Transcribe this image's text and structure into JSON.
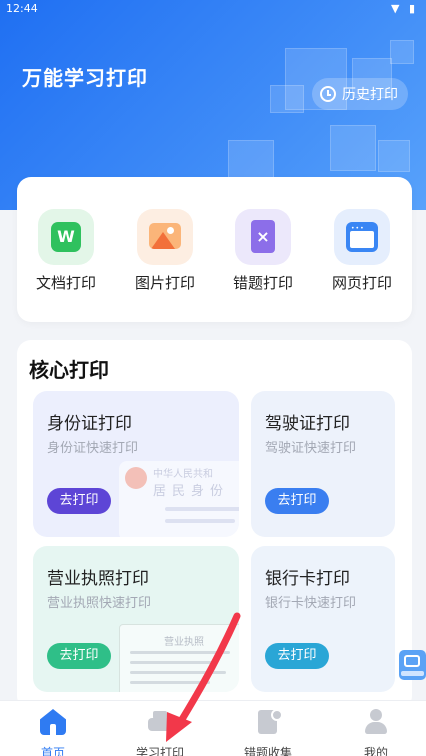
{
  "status_bar": {
    "time": "12:44",
    "icons": "▼ ▮"
  },
  "header": {
    "title": "万能学习打印",
    "history_label": "历史打印"
  },
  "quick_actions": [
    {
      "label": "文档打印",
      "icon": "word-doc-icon",
      "glyph": "W"
    },
    {
      "label": "图片打印",
      "icon": "image-icon"
    },
    {
      "label": "错题打印",
      "icon": "wrong-question-icon",
      "glyph": "×"
    },
    {
      "label": "网页打印",
      "icon": "web-page-icon",
      "glyph": "•••"
    }
  ],
  "core": {
    "title": "核心打印",
    "cards": [
      {
        "title": "身份证打印",
        "subtitle": "身份证快速打印",
        "button": "去打印",
        "art": {
          "line1": "中华人民共和",
          "line2": "居民身份"
        }
      },
      {
        "title": "驾驶证打印",
        "subtitle": "驾驶证快速打印",
        "button": "去打印"
      },
      {
        "title": "营业执照打印",
        "subtitle": "营业执照快速打印",
        "button": "去打印",
        "art": {
          "heading": "营业执照"
        }
      },
      {
        "title": "银行卡打印",
        "subtitle": "银行卡快速打印",
        "button": "去打印"
      }
    ]
  },
  "tabs": [
    {
      "label": "首页",
      "icon": "home-icon",
      "active": true
    },
    {
      "label": "学习打印",
      "icon": "printer-icon",
      "active": false
    },
    {
      "label": "错题收集",
      "icon": "wrong-question-collect-icon",
      "active": false
    },
    {
      "label": "我的",
      "icon": "profile-icon",
      "active": false
    }
  ],
  "colors": {
    "primary": "#2f7bf2",
    "annotation_arrow": "#f2384a"
  }
}
